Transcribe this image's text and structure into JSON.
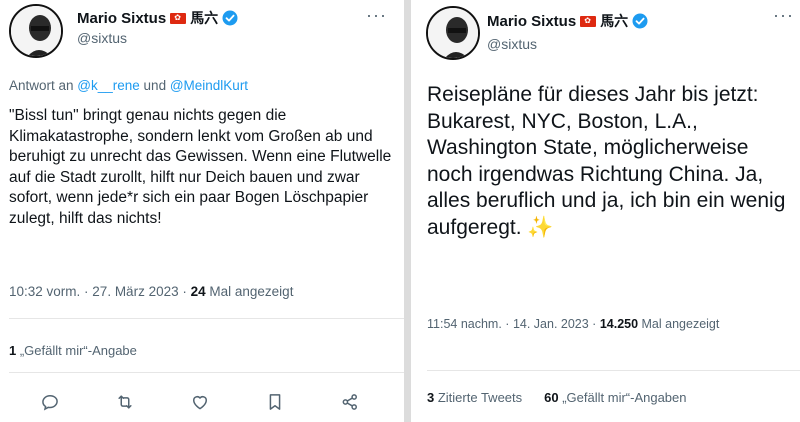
{
  "left_tweet": {
    "author_name": "Mario Sixtus",
    "author_cjk": "馬六",
    "handle": "@sixtus",
    "reply_prefix": "Antwort an ",
    "reply_mention_1": "@k__rene",
    "reply_joiner": " und ",
    "reply_mention_2": "@MeindlKurt",
    "text": "\"Bissl tun\" bringt genau nichts gegen die Klimakatastrophe, sondern lenkt vom Großen ab und beruhigt zu unrecht das Gewissen. Wenn eine Flutwelle auf die Stadt zurollt, hilft nur Deich bauen und zwar sofort, wenn jede*r sich ein paar Bogen Löschpapier zulegt, hilft das nichts!",
    "time": "10:32 vorm.",
    "separator": " · ",
    "date": "27. März 2023",
    "views_count": "24",
    "views_label": " Mal angezeigt",
    "likes_count": "1",
    "likes_label": " „Gefällt mir“-Angabe"
  },
  "right_tweet": {
    "author_name": "Mario Sixtus",
    "author_cjk": "馬六",
    "handle": "@sixtus",
    "text": "Reisepläne für dieses Jahr bis jetzt: Bukarest, NYC, Boston, L.A., Washington State, möglicherweise noch irgendwas Richtung China. Ja, alles beruflich und ja, ich bin ein wenig aufgeregt.",
    "emoji": "✨",
    "time": "11:54 nachm.",
    "separator": " · ",
    "date": "14. Jan. 2023",
    "views_count": "14.250",
    "views_label": " Mal angezeigt",
    "quotes_count": "3",
    "quotes_label": " Zitierte Tweets",
    "likes_count": "60",
    "likes_label": " „Gefällt mir“-Angaben"
  },
  "icons": {
    "more": "more-icon",
    "verified": "verified-badge-icon",
    "flag": "hong-kong-flag-icon",
    "reply": "reply-icon",
    "retweet": "retweet-icon",
    "like": "like-icon",
    "bookmark": "bookmark-icon",
    "share": "share-icon"
  },
  "colors": {
    "accent": "#1d9bf0",
    "text": "#0f1419",
    "secondary": "#536471",
    "flag_red": "#de2910"
  }
}
